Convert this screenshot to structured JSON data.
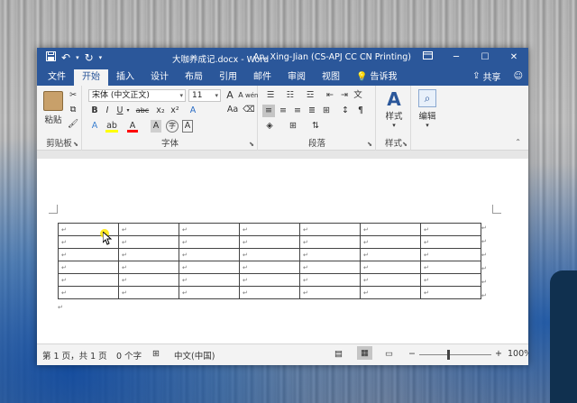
{
  "window": {
    "title": "大咖养成记.docx  -  Word",
    "user": "An, Xing-Jian (CS-APJ CC CN Printing)",
    "quick_access": [
      "save-icon",
      "undo-icon",
      "redo-icon",
      "customize-icon"
    ],
    "controls": [
      "restore-ribbon-icon",
      "minimize-icon",
      "maximize-icon",
      "close-icon"
    ]
  },
  "tabs": [
    "文件",
    "开始",
    "插入",
    "设计",
    "布局",
    "引用",
    "邮件",
    "审阅",
    "视图"
  ],
  "tabs_active": "开始",
  "tell_me": "告诉我",
  "share": "共享",
  "ribbon": {
    "clipboard": {
      "paste": "粘贴",
      "label": "剪贴板"
    },
    "font": {
      "label": "字体",
      "font_name": "宋体 (中文正文)",
      "font_size": "11",
      "grow": "A",
      "shrink": "A",
      "case": "Aa",
      "phonetic": "wén",
      "bold": "B",
      "italic": "I",
      "underline": "U",
      "strike": "abc",
      "subscript": "x₂",
      "superscript": "x²",
      "effects": "A",
      "highlight": "ab",
      "color": "A",
      "charshade": "A",
      "enclose": "字",
      "border": "A"
    },
    "paragraph": {
      "label": "段落"
    },
    "styles": {
      "label": "样式",
      "styles_btn": "样式"
    },
    "editing": {
      "editing_btn": "编辑"
    }
  },
  "document": {
    "table": {
      "rows": 6,
      "cols": 7,
      "cell_mark": "↵"
    },
    "paragraph_mark": "↵"
  },
  "status": {
    "page": "第 1 页，共 1 页",
    "words": "0 个字",
    "language": "中文(中国)",
    "zoom": "100%",
    "zoom_minus": "−",
    "zoom_plus": "+"
  },
  "colors": {
    "titlebar": "#2b579a",
    "highlight": "#ffff00",
    "font_color": "#ff0000"
  }
}
